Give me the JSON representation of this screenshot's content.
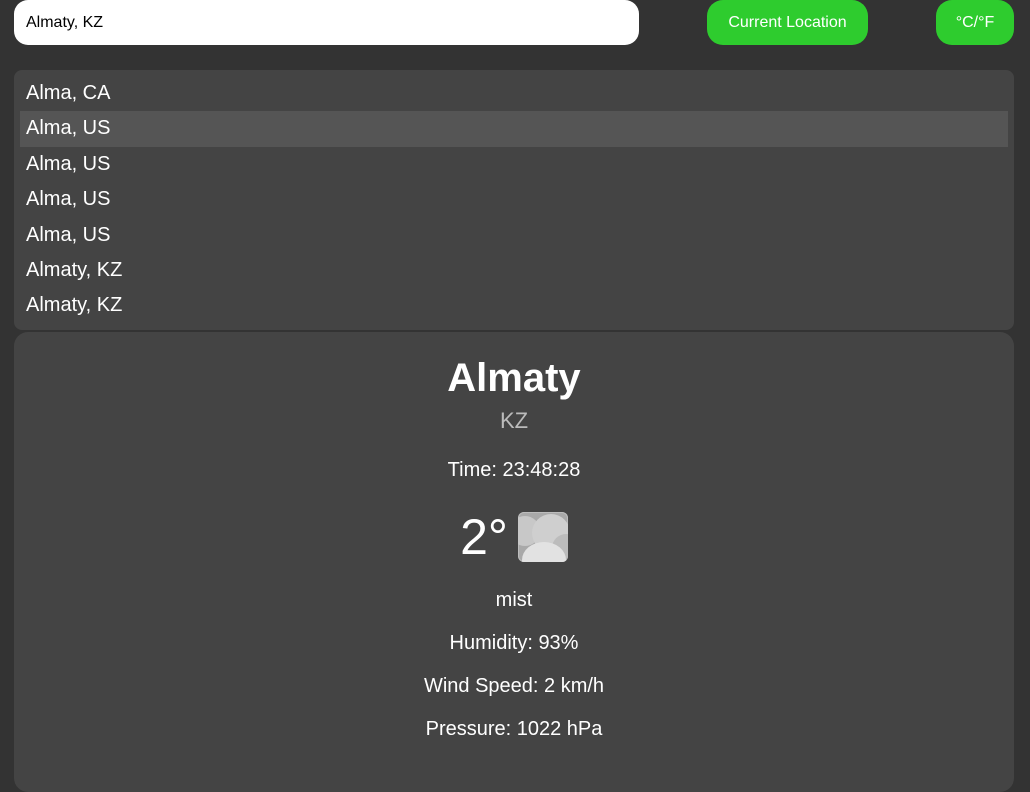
{
  "search": {
    "value": "Almaty, KZ"
  },
  "buttons": {
    "current_location": "Current Location",
    "units": "°C/°F"
  },
  "suggestions": [
    {
      "label": "Alma, CA"
    },
    {
      "label": "Alma, US",
      "highlighted": true
    },
    {
      "label": "Alma, US"
    },
    {
      "label": "Alma, US"
    },
    {
      "label": "Alma, US"
    },
    {
      "label": "Almaty, KZ"
    },
    {
      "label": "Almaty, KZ"
    }
  ],
  "weather": {
    "city": "Almaty",
    "country": "KZ",
    "time": "Time: 23:48:28",
    "temperature": "2°",
    "icon": "mist-cloud-icon",
    "description": "mist",
    "humidity": "Humidity: 93%",
    "wind_speed": "Wind Speed: 2 km/h",
    "pressure": "Pressure: 1022 hPa"
  },
  "colors": {
    "background": "#333333",
    "panel": "#444444",
    "highlight": "#555555",
    "accent": "#2ecc2e"
  }
}
